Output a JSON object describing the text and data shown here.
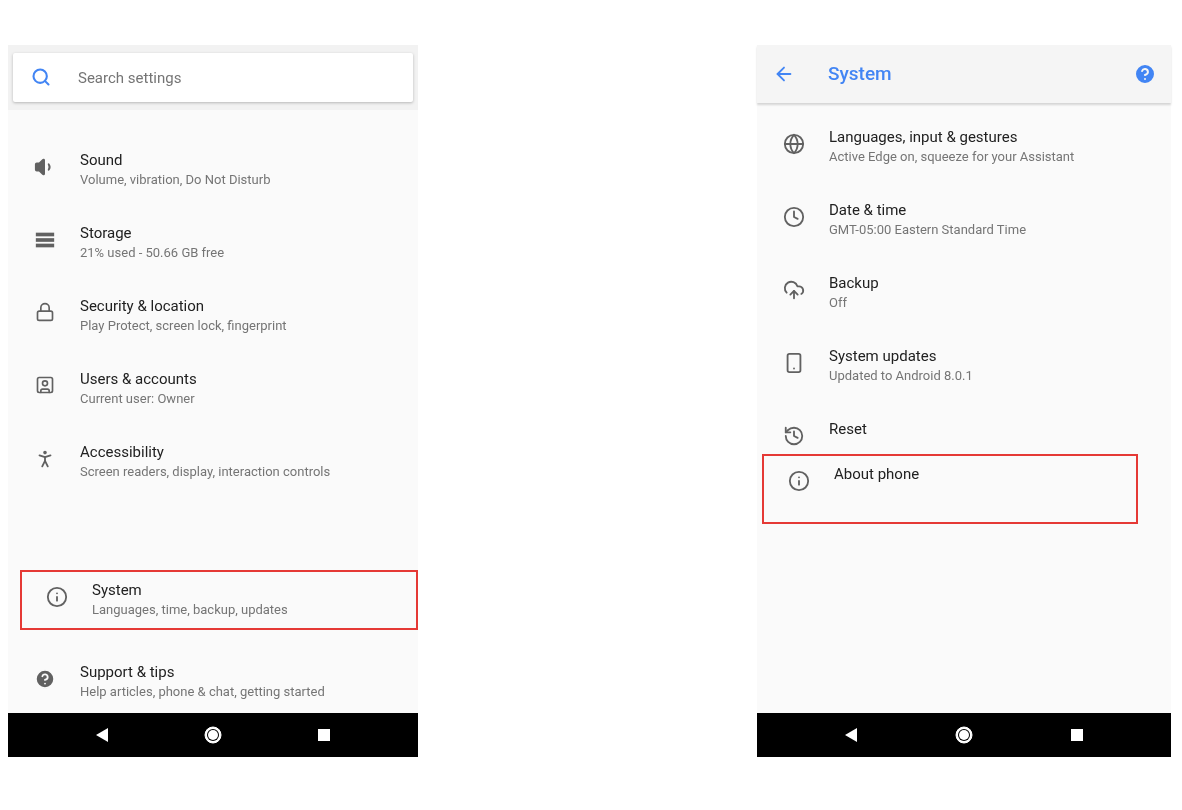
{
  "settings_screen": {
    "search": {
      "placeholder": "Search settings"
    },
    "items": [
      {
        "title": "Sound",
        "subtitle": "Volume, vibration, Do Not Disturb",
        "highlighted": false
      },
      {
        "title": "Storage",
        "subtitle": "21% used - 50.66 GB free",
        "highlighted": false
      },
      {
        "title": "Security & location",
        "subtitle": "Play Protect, screen lock, fingerprint",
        "highlighted": false
      },
      {
        "title": "Users & accounts",
        "subtitle": "Current user: Owner",
        "highlighted": false
      },
      {
        "title": "Accessibility",
        "subtitle": "Screen readers, display, interaction controls",
        "highlighted": false
      }
    ],
    "bottom_items": [
      {
        "title": "System",
        "subtitle": "Languages, time, backup, updates",
        "highlighted": true
      },
      {
        "title": "Support & tips",
        "subtitle": "Help articles, phone & chat, getting started",
        "highlighted": false
      }
    ]
  },
  "system_screen": {
    "title": "System",
    "items": [
      {
        "title": "Languages, input & gestures",
        "subtitle": "Active Edge on, squeeze for your Assistant",
        "highlighted": false
      },
      {
        "title": "Date & time",
        "subtitle": "GMT-05:00 Eastern Standard Time",
        "highlighted": false
      },
      {
        "title": "Backup",
        "subtitle": "Off",
        "highlighted": false
      },
      {
        "title": "System updates",
        "subtitle": "Updated to Android 8.0.1",
        "highlighted": false
      },
      {
        "title": "Reset",
        "highlighted": false
      },
      {
        "title": "About phone",
        "highlighted": true
      }
    ]
  }
}
